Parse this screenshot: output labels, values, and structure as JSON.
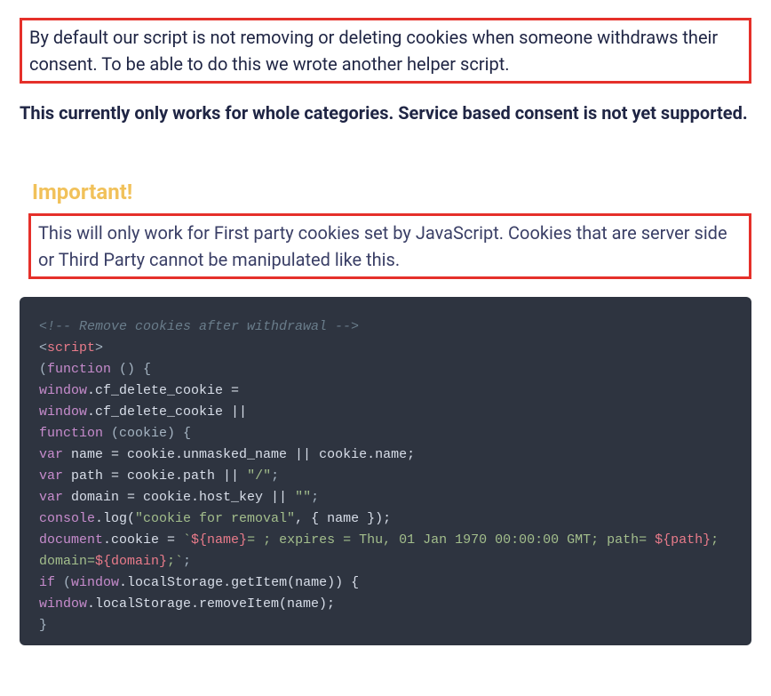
{
  "intro": "By default our script is not removing or deleting cookies when someone withdraws their consent. To be able to do this we wrote another helper script.",
  "bold_note": "This currently only works for whole categories. Service based consent is not yet supported.",
  "callout": {
    "title": "Important!",
    "body": "This will only work for First party cookies set by JavaScript. Cookies that are server side or Third Party cannot be manipulated like this."
  },
  "code": {
    "c1": "<!-- Remove cookies after withdrawal -->",
    "lt": "<",
    "gt": ">",
    "script": "script",
    "function": "function",
    "window": "window",
    "var": "var",
    "console": "console",
    "document": "document",
    "if": "if",
    "cf_delete_cookie": ".cf_delete_cookie",
    "unmasked_or_name": " name = cookie.unmasked_name || cookie.name;",
    "path_line_a": " path = cookie.path || ",
    "slash": "\"/\"",
    "domain_line_a": " domain = cookie.host_key || ",
    "empty": "\"\"",
    "log_a": ".log(",
    "log_str": "\"cookie for removal\"",
    "log_b": ", { name });",
    "cookie_a": ".cookie = ",
    "tmpl_open": "`",
    "tmpl_name": "${name}",
    "tmpl_mid": "= ; expires = Thu, 01 Jan 1970 00:00:00 GMT; path= ",
    "tmpl_path": "${path}",
    "tmpl_semi": ";",
    "domain_prefix": "domain=",
    "tmpl_domain": "${domain}",
    "tmpl_close": ";`",
    "ls_get": ".localStorage.getItem(name)) {",
    "ls_rem": ".localStorage.removeItem(name);"
  }
}
